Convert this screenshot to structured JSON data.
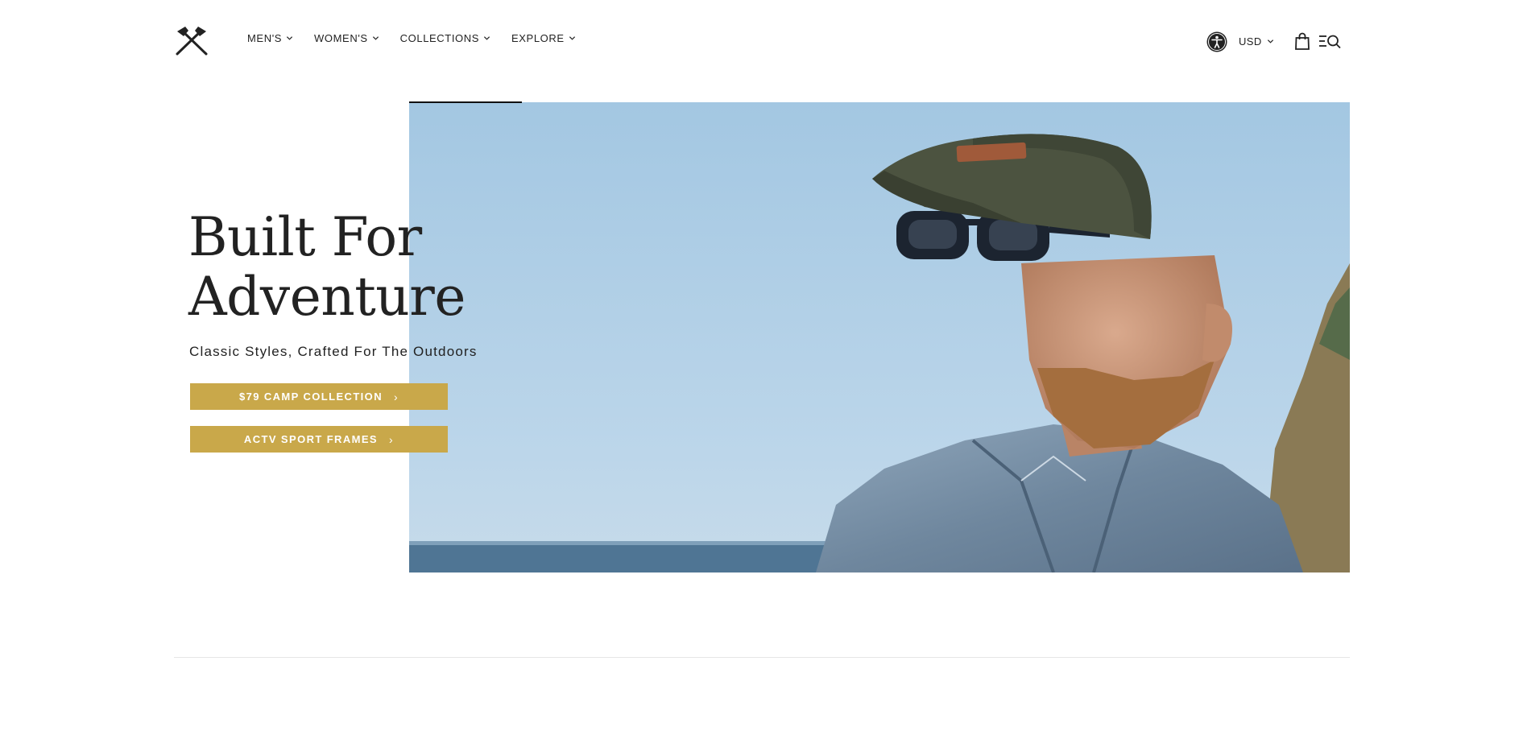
{
  "nav": {
    "items": [
      {
        "label": "MEN'S"
      },
      {
        "label": "WOMEN'S"
      },
      {
        "label": "COLLECTIONS"
      },
      {
        "label": "EXPLORE"
      }
    ],
    "logo_icon": "crossed-axes-icon"
  },
  "utility": {
    "accessibility_icon": "accessibility-icon",
    "currency": "USD",
    "bag_icon": "shopping-bag-icon",
    "menu_search_icon": "menu-search-icon"
  },
  "hero": {
    "title_line1": "Built For",
    "title_line2": "Adventure",
    "subtitle": "Classic Styles, Crafted For The Outdoors",
    "cta_primary": "$79 CAMP COLLECTION",
    "cta_secondary": "ACTV SPORT FRAMES",
    "arrow": "›",
    "image_subject": "man-in-cap-and-sunglasses-photo"
  },
  "colors": {
    "accent_gold": "#c9a84a",
    "text": "#222222",
    "sky": "#a9cbe4"
  }
}
